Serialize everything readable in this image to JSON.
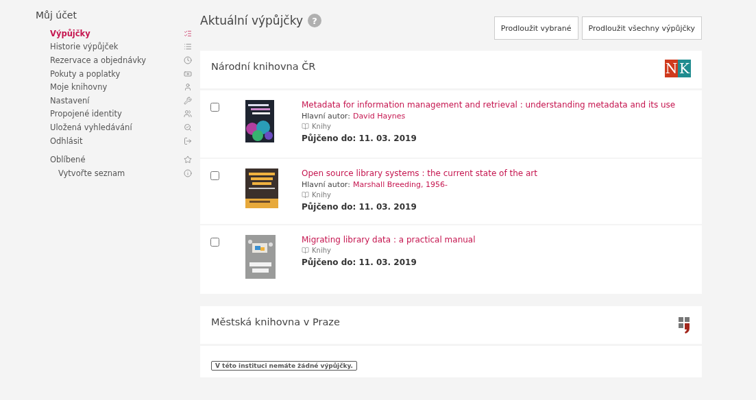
{
  "sidebar": {
    "title": "Můj účet",
    "items": [
      {
        "label": "Výpůjčky",
        "selected": true
      },
      {
        "label": "Historie výpůjček",
        "selected": false
      },
      {
        "label": "Rezervace a objednávky",
        "selected": false
      },
      {
        "label": "Pokuty a poplatky",
        "selected": false
      },
      {
        "label": "Moje knihovny",
        "selected": false
      },
      {
        "label": "Nastavení",
        "selected": false
      },
      {
        "label": "Propojené identity",
        "selected": false
      },
      {
        "label": "Uložená vyhledávání",
        "selected": false
      },
      {
        "label": "Odhlásit",
        "selected": false
      }
    ],
    "favorites": {
      "label": "Oblíbené",
      "children": [
        {
          "label": "Vytvořte seznam"
        }
      ]
    }
  },
  "header": {
    "title": "Aktuální výpůjčky",
    "help": "?",
    "buttons": [
      "Prodloužit vybrané",
      "Prodloužit všechny výpůjčky"
    ]
  },
  "libraries": [
    {
      "name": "Národní knihovna ČR",
      "logo": {
        "kind": "letters",
        "letters": [
          "N",
          "K"
        ]
      },
      "loans": [
        {
          "checked": false,
          "title": "Metadata for information management and retrieval : understanding metadata and its use",
          "author_label": "Hlavní autor:",
          "author": "David Haynes",
          "format": "Knihy",
          "due": "Půjčeno do: 11. 03. 2019"
        },
        {
          "checked": false,
          "title": "Open source library systems : the current state of the art",
          "author_label": "Hlavní autor:",
          "author": "Marshall Breeding, 1956-",
          "format": "Knihy",
          "due": "Půjčeno do: 11. 03. 2019"
        },
        {
          "checked": false,
          "title": "Migrating library data : a practical manual",
          "format": "Knihy",
          "due": "Půjčeno do: 11. 03. 2019"
        }
      ]
    },
    {
      "name": "Městská knihovna v Praze",
      "logo": {
        "kind": "squares"
      },
      "message": "V této instituci nemáte žádné výpůjčky."
    }
  ]
}
